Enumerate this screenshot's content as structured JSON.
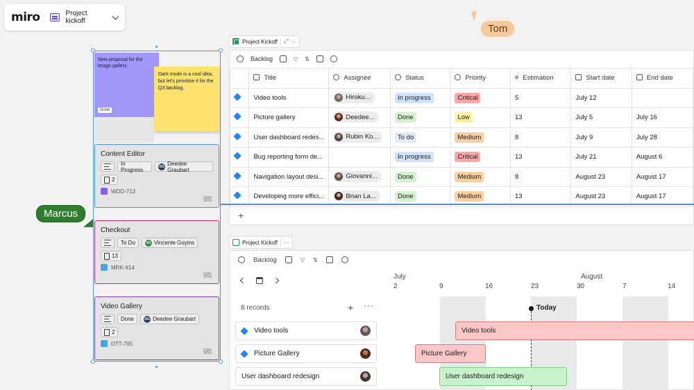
{
  "app": {
    "logo": "miro",
    "board_title": "Project kickoff"
  },
  "cursors": {
    "tom": "Tom",
    "marcus": "Marcus"
  },
  "stickies": {
    "purple": {
      "text": "New proposal for the image gallery",
      "chip": "Done"
    },
    "yellow": {
      "text": "Dark mode is a cool idea, but let's prioritize it for the Q3 backlog."
    }
  },
  "cards": [
    {
      "title": "Content Editor",
      "status": "In Progress",
      "assignee": "Deedee Graubart",
      "initials": "DG",
      "estimate": "2",
      "key": "WDD-713",
      "color": "#4a90e2",
      "key_color": "#8a5cf6"
    },
    {
      "title": "Checkout",
      "status": "To Do",
      "assignee": "Vincente Goyins",
      "initials": "VG",
      "estimate": "13",
      "key": "MRK-614",
      "color": "#d6246e",
      "key_color": "#4aa3e8"
    },
    {
      "title": "Video Gallery",
      "status": "Done",
      "assignee": "Deedee Graubart",
      "initials": "DG",
      "estimate": "2",
      "key": "DTT-765",
      "color": "#7b3fb6",
      "key_color": "#4aa3e8"
    }
  ],
  "table": {
    "tag": "Project Kickoff",
    "toolbar_label": "Backlog",
    "columns": [
      "Title",
      "Assignee",
      "Status",
      "Priority",
      "Estimation",
      "Start date",
      "End date"
    ],
    "rows": [
      {
        "title": "Video tools",
        "assignee": "Hiroku...",
        "status": "In progress",
        "priority": "Critical",
        "estimation": "5",
        "start": "July 12",
        "end": ""
      },
      {
        "title": "Picture gallery",
        "assignee": "Deedee...",
        "status": "Done",
        "priority": "Low",
        "estimation": "13",
        "start": "July 5",
        "end": "July 16"
      },
      {
        "title": "User dashboard redes...",
        "assignee": "Rubin Ko...",
        "status": "To do",
        "priority": "Medium",
        "estimation": "8",
        "start": "July 9",
        "end": "July 28"
      },
      {
        "title": "Bug reporting form de...",
        "assignee": "",
        "status": "In progress",
        "priority": "Critical",
        "estimation": "13",
        "start": "July 21",
        "end": "August 6"
      },
      {
        "title": "Navigation layout desi...",
        "assignee": "Giovanni...",
        "status": "Done",
        "priority": "Medium",
        "estimation": "8",
        "start": "August 23",
        "end": "August 17"
      },
      {
        "title": "Developing more effici...",
        "assignee": "Brian La...",
        "status": "Done",
        "priority": "Medium",
        "estimation": "13",
        "start": "August 23",
        "end": "August 17"
      }
    ],
    "add": "+"
  },
  "timeline": {
    "tag": "Project Kickoff",
    "toolbar_label": "Backlog",
    "months": [
      "July",
      "August"
    ],
    "days": [
      "2",
      "9",
      "16",
      "23",
      "30",
      "7",
      "14"
    ],
    "records_label": "8 records",
    "today_label": "Today",
    "items": [
      {
        "name": "Video tools",
        "bar": "Video tools"
      },
      {
        "name": "Picture Gallery",
        "bar": "Picture Gallery"
      },
      {
        "name": "User dashboard redesign",
        "bar": "User dashboard redesign"
      }
    ]
  },
  "colors": {
    "status": {
      "In progress": "#cfe3ff",
      "Done": "#d6f2d0",
      "To do": "#e3eaf7"
    },
    "priority": {
      "Critical": "#f9a7a7",
      "Low": "#fff3a6",
      "Medium": "#fbcfa0"
    }
  }
}
